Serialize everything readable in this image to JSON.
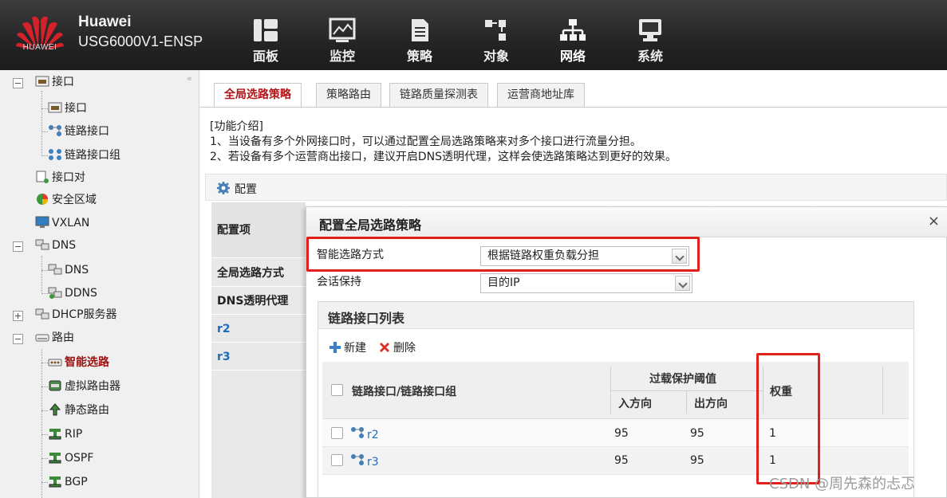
{
  "header": {
    "logo_text": "HUAWEI",
    "brand": "Huawei",
    "model": "USG6000V1-ENSP",
    "nav": [
      {
        "label": "面板",
        "icon": "dashboard-icon"
      },
      {
        "label": "监控",
        "icon": "monitor-icon"
      },
      {
        "label": "策略",
        "icon": "policy-icon"
      },
      {
        "label": "对象",
        "icon": "object-icon"
      },
      {
        "label": "网络",
        "icon": "network-icon",
        "active": true
      },
      {
        "label": "系统",
        "icon": "system-icon"
      }
    ]
  },
  "sidebar": {
    "items": [
      {
        "label": "接口",
        "icon": "interface-icon"
      },
      {
        "label": "接口",
        "icon": "interface-icon"
      },
      {
        "label": "链路接口",
        "icon": "link-interface-icon"
      },
      {
        "label": "链路接口组",
        "icon": "link-interface-group-icon"
      },
      {
        "label": "接口对",
        "icon": "interface-pair-icon"
      },
      {
        "label": "安全区域",
        "icon": "security-zone-icon"
      },
      {
        "label": "VXLAN",
        "icon": "vxlan-icon"
      },
      {
        "label": "DNS",
        "icon": "dns-icon"
      },
      {
        "label": "DNS",
        "icon": "dns-icon"
      },
      {
        "label": "DDNS",
        "icon": "ddns-icon"
      },
      {
        "label": "DHCP服务器",
        "icon": "dhcp-icon"
      },
      {
        "label": "路由",
        "icon": "route-icon"
      },
      {
        "label": "智能选路",
        "icon": "smart-route-icon",
        "selected": true
      },
      {
        "label": "虚拟路由器",
        "icon": "virtual-router-icon"
      },
      {
        "label": "静态路由",
        "icon": "static-route-icon"
      },
      {
        "label": "RIP",
        "icon": "rip-icon"
      },
      {
        "label": "OSPF",
        "icon": "ospf-icon"
      },
      {
        "label": "BGP",
        "icon": "bgp-icon"
      }
    ]
  },
  "tabs": [
    {
      "label": "全局选路策略",
      "active": true
    },
    {
      "label": "策略路由"
    },
    {
      "label": "链路质量探测表"
    },
    {
      "label": "运营商地址库"
    }
  ],
  "intro": {
    "title": "[功能介绍]",
    "line1": "1、当设备有多个外网接口时，可以通过配置全局选路策略来对多个接口进行流量分担。",
    "line2": "2、若设备有多个运营商出接口，建议开启DNS透明代理，这样会使选路策略达到更好的效果。"
  },
  "config": {
    "bar_label": "配置",
    "column_header": "配置项",
    "items": [
      "全局选路方式",
      "DNS透明代理",
      "r2",
      "r3"
    ]
  },
  "dialog": {
    "title": "配置全局选路策略",
    "close": "×",
    "smart_route_label": "智能选路方式",
    "smart_route_value": "根据链路权重负载分担",
    "session_label": "会话保持",
    "session_value": "目的IP",
    "list": {
      "title": "链路接口列表",
      "add": "新建",
      "delete": "删除",
      "columns": {
        "name": "链路接口/链路接口组",
        "overload": "过载保护阈值",
        "inbound": "入方向",
        "outbound": "出方向",
        "weight": "权重"
      },
      "rows": [
        {
          "name": "r2",
          "inbound": "95",
          "outbound": "95",
          "weight": "1"
        },
        {
          "name": "r3",
          "inbound": "95",
          "outbound": "95",
          "weight": "1"
        }
      ]
    }
  },
  "watermark": "CSDN @周先森的忐忑",
  "colors": {
    "accent_red": "#b0141a",
    "highlight_red": "#e0201b",
    "link_blue": "#1f6bb8",
    "header_bg": "#2a2a2a"
  }
}
